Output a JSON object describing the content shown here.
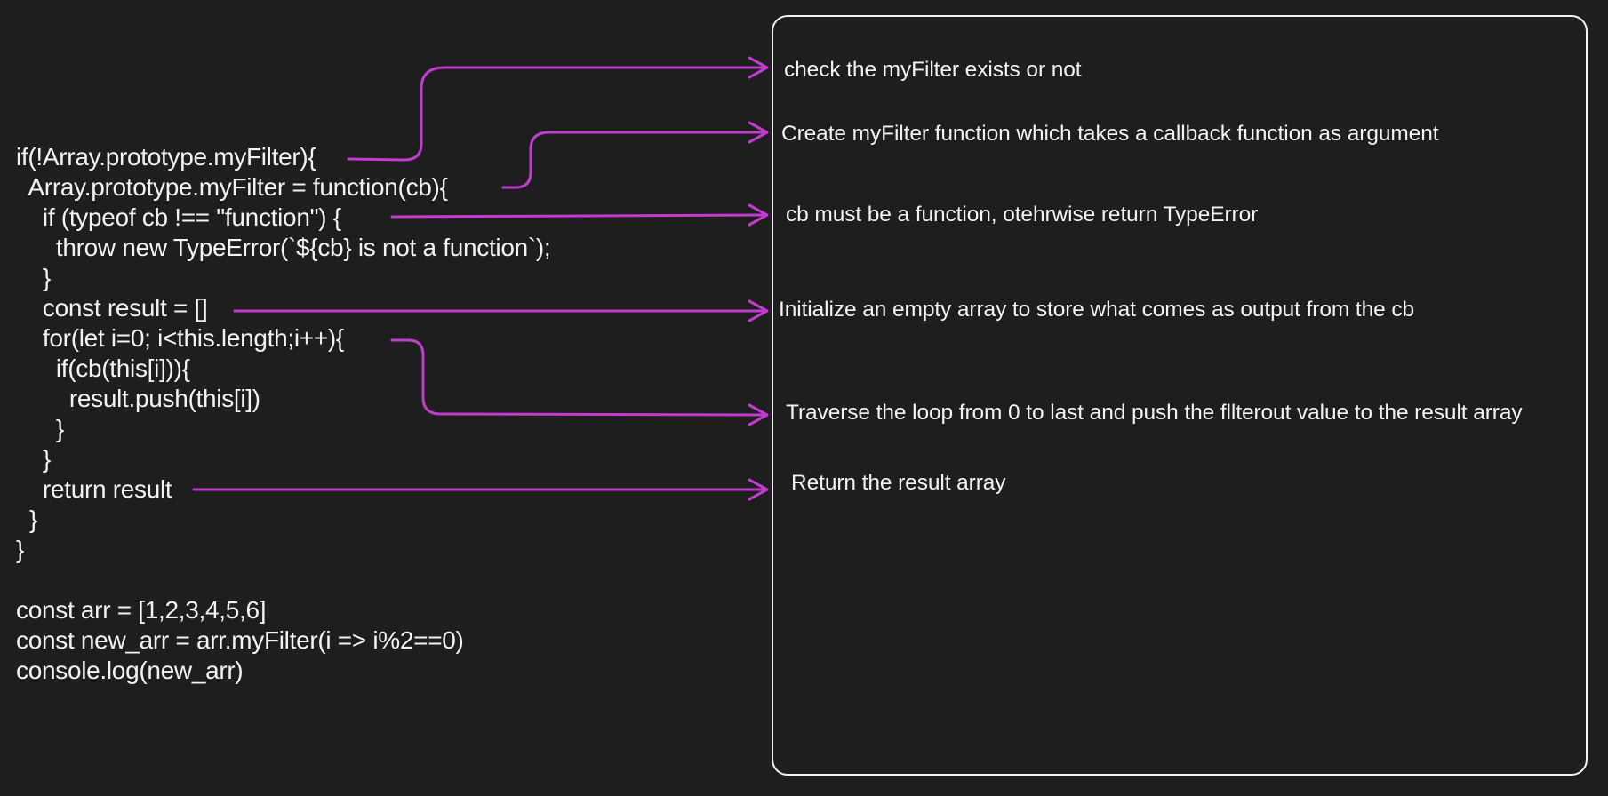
{
  "code": {
    "lines": [
      "if(!Array.prototype.myFilter){",
      "  Array.prototype.myFilter = function(cb){",
      "    if (typeof cb !== \"function\") {",
      "      throw new TypeError(`${cb} is not a function`);",
      "    }",
      "    const result = []",
      "    for(let i=0; i<this.length;i++){",
      "      if(cb(this[i])){",
      "        result.push(this[i])",
      "      }",
      "    }",
      "    return result",
      "  }",
      "}",
      "",
      "const arr = [1,2,3,4,5,6]",
      "const new_arr = arr.myFilter(i => i%2==0)",
      "console.log(new_arr)"
    ]
  },
  "notes": [
    "check the myFilter exists or not",
    "Create myFilter function which takes a callback function as argument",
    "cb must be a function, otehrwise return TypeError",
    "Initialize an empty array to store what comes as output from the cb",
    "Traverse the loop from 0 to last and push the fllterout value to the result array",
    "Return the result array"
  ],
  "colors": {
    "background": "#1e1e1f",
    "text": "#f2f2f2",
    "arrow": "#c13ccf",
    "box_border": "#f2f2f2"
  }
}
